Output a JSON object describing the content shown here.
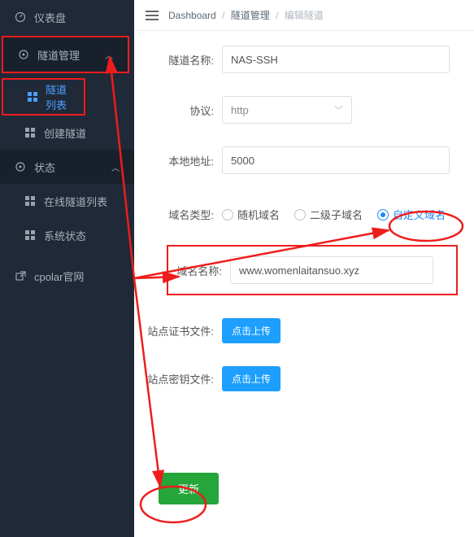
{
  "sidebar": {
    "dashboard": "仪表盘",
    "tunnel_mgmt": "隧道管理",
    "tunnel_list": "隧道列表",
    "create_tunnel": "创建隧道",
    "status": "状态",
    "online_tunnels": "在线隧道列表",
    "system_status": "系统状态",
    "cpolar_site": "cpolar官网"
  },
  "breadcrumb": {
    "root": "Dashboard",
    "mid": "隧道管理",
    "cur": "编辑隧道"
  },
  "form": {
    "name_label": "隧道名称:",
    "name_value": "NAS-SSH",
    "proto_label": "协议:",
    "proto_value": "http",
    "addr_label": "本地地址:",
    "addr_value": "5000",
    "domain_type_label": "域名类型:",
    "radio_random": "随机域名",
    "radio_sub": "二级子域名",
    "radio_custom": "自定义域名",
    "domain_label": "域名名称:",
    "domain_value": "www.womenlaitansuo.xyz",
    "cert_label": "站点证书文件:",
    "key_label": "站点密钥文件:",
    "upload_btn": "点击上传",
    "save_btn": "更新"
  }
}
